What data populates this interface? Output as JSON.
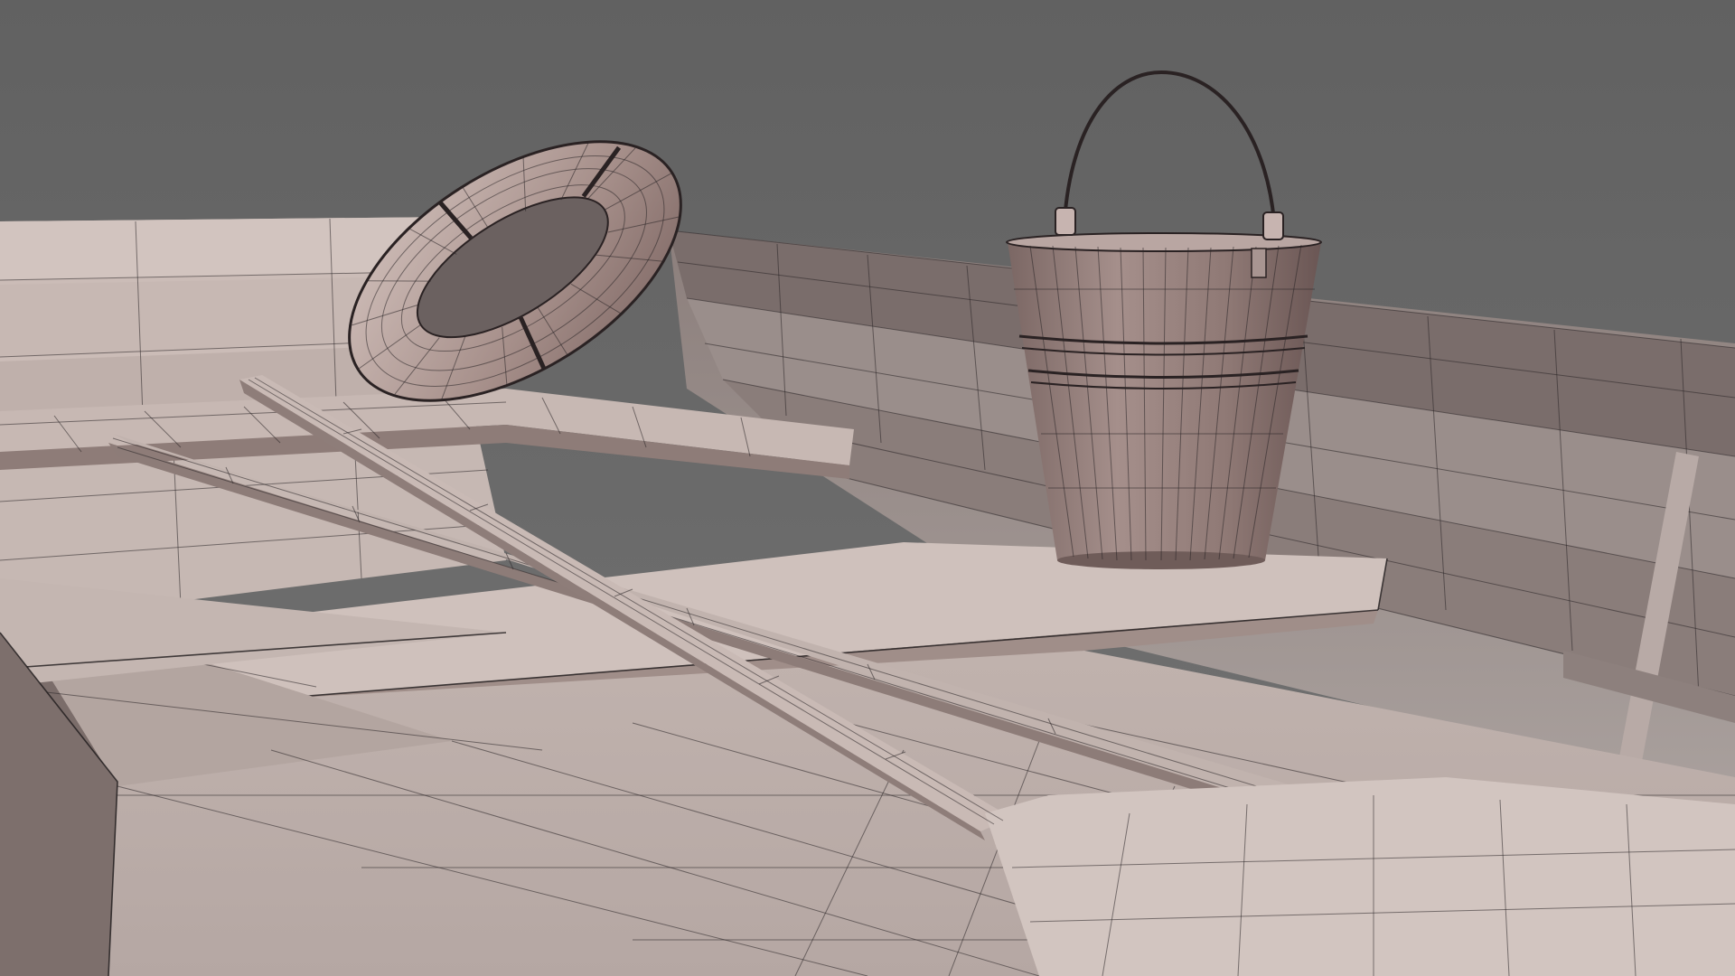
{
  "scene": {
    "kind": "3D wireframe render viewport",
    "objects": [
      "rowboat-hull",
      "life-ring",
      "bucket",
      "oar-left",
      "oar-right",
      "thwart-bench"
    ],
    "colors": {
      "background_top": "#626262",
      "background_bottom": "#6e6e6e",
      "hull_light": "#cdbfba",
      "hull_mid": "#a89994",
      "hull_dark": "#7f7270",
      "bucket_body": "#9f8783",
      "bucket_dark": "#6e5a57",
      "ring_light": "#c9b6b1",
      "ring_dark": "#7a6562",
      "oar": "#bfb1ac",
      "wire": "#2a2426"
    }
  }
}
